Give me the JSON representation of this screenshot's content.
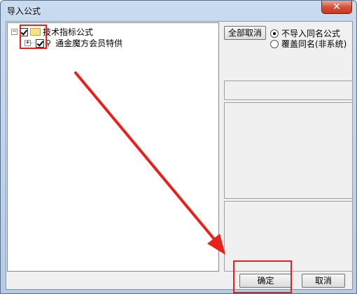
{
  "window": {
    "title": "导入公式",
    "close_glyph": "✕"
  },
  "tree": {
    "root": {
      "expander": "⊟",
      "label": "技术指标公式",
      "checked": true
    },
    "child": {
      "expander": "⊞",
      "label": "通金魔方会员特供",
      "checked": true
    }
  },
  "options": {
    "deselect_all_label": "全部取消",
    "radio_no_import": "不导入同名公式",
    "radio_overwrite": "覆盖同名(非系统)",
    "selected": "no_import"
  },
  "footer": {
    "ok_label": "确定",
    "cancel_label": "取消"
  },
  "annotation": {
    "color": "#e8211b"
  }
}
